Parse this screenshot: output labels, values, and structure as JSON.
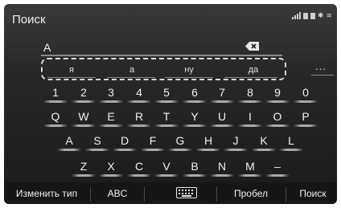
{
  "header": {
    "title": "Поиск"
  },
  "input": {
    "value": "A"
  },
  "suggestions": [
    "я",
    "а",
    "ну",
    "да"
  ],
  "more_label": "...",
  "keyboard": {
    "row1": [
      "1",
      "2",
      "3",
      "4",
      "5",
      "6",
      "7",
      "8",
      "9",
      "0"
    ],
    "row2": [
      "Q",
      "W",
      "E",
      "R",
      "T",
      "Y",
      "U",
      "I",
      "O",
      "P"
    ],
    "row3": [
      "A",
      "S",
      "D",
      "F",
      "G",
      "H",
      "J",
      "K",
      "L"
    ],
    "row4": [
      "Z",
      "X",
      "C",
      "V",
      "B",
      "N",
      "M",
      "–"
    ]
  },
  "bottom": {
    "change_type": "Изменить тип",
    "abc": "ABC",
    "space": "Пробел",
    "search": "Поиск"
  }
}
